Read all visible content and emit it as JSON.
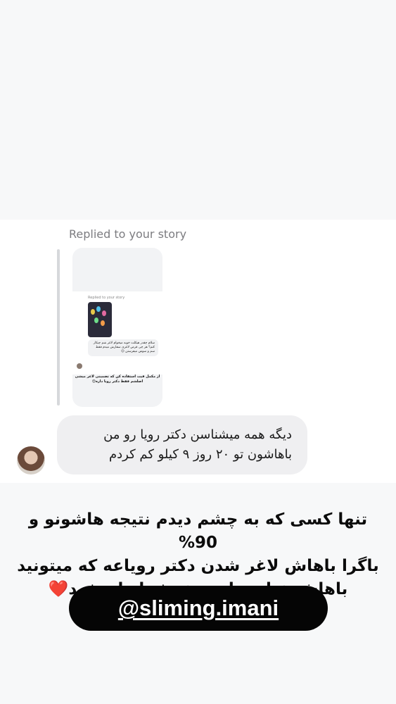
{
  "story_reply": {
    "replied_label": "Replied to your story",
    "mini_replied_label": "Replied to your story",
    "mini_message": "سلام چقدر هیکلت خوبه میخوام لاغر شم چیکار کنم؟ هر چی قرص لاغری سفارش میدم فقط سم و سوس میفرستن 😔",
    "mini_reply": "از مکمل فیت استفاده کن که تضمینی لاغر میشی اصلشم فقط دکتر رویا داره😌"
  },
  "message": {
    "line1": "دیگه همه میشناسن دکتر رویا رو من",
    "line2": "باهاشون تو ۲۰ روز ۹ کیلو کم کردم"
  },
  "caption": {
    "line1": "تنها کسی که به چشم دیدم نتیجه هاشونو و 90%",
    "line2": "باگرا باهاش لاغر شدن دکتر رویاعه که میتونید",
    "line3": "باهاش خیلی راحت خوش اندام شید❤️"
  },
  "handle": {
    "text": "@sliming.imani"
  }
}
